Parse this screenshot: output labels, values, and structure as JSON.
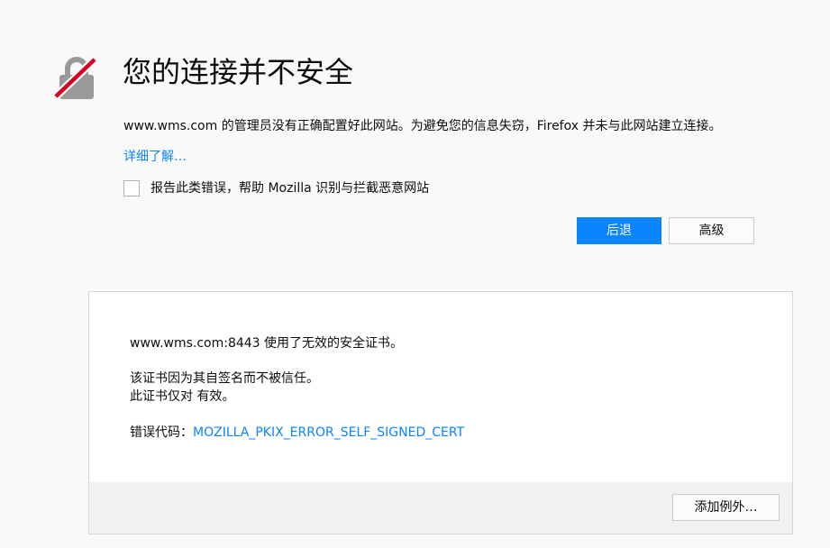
{
  "error": {
    "title": "您的连接并不安全",
    "description": "www.wms.com 的管理员没有正确配置好此网站。为避免您的信息失窃，Firefox 并未与此网站建立连接。",
    "learn_more_label": "详细了解…",
    "report_label": "报告此类错误，帮助 Mozilla 识别与拦截恶意网站",
    "report_checked": false
  },
  "buttons": {
    "back_label": "后退",
    "advanced_label": "高级"
  },
  "advanced": {
    "line1": "www.wms.com:8443 使用了无效的安全证书。",
    "line2": "该证书因为其自签名而不被信任。",
    "line3": "此证书仅对  有效。",
    "error_code_prefix": "错误代码：",
    "error_code": "MOZILLA_PKIX_ERROR_SELF_SIGNED_CERT",
    "add_exception_label": "添加例外…"
  },
  "icons": {
    "lock": "broken-lock-icon"
  },
  "colors": {
    "accent": "#0a84ff",
    "strike": "#d70022",
    "lock_gray": "#999999",
    "background": "#f9f9fa"
  }
}
